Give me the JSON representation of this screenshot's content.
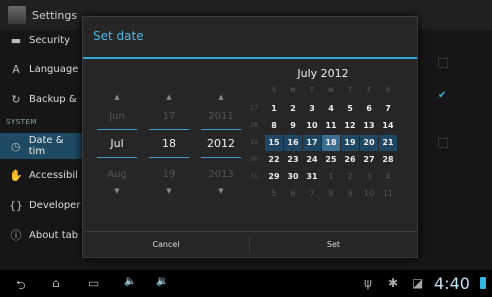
{
  "app": {
    "title": "Settings"
  },
  "sidebar": {
    "items": [
      {
        "label": "Security",
        "icon": "lock-icon"
      },
      {
        "label": "Language",
        "icon": "language-icon"
      },
      {
        "label": "Backup &",
        "icon": "backup-icon"
      },
      {
        "label": "Date & tim",
        "icon": "clock-icon"
      },
      {
        "label": "Accessibil",
        "icon": "hand-icon"
      },
      {
        "label": "Developer",
        "icon": "braces-icon"
      },
      {
        "label": "About tab",
        "icon": "info-icon"
      }
    ],
    "section_header": "SYSTEM"
  },
  "dialog": {
    "title": "Set date",
    "month": {
      "prev": "Jun",
      "current": "Jul",
      "next": "Aug"
    },
    "day": {
      "prev": "17",
      "current": "18",
      "next": "19"
    },
    "year": {
      "prev": "2011",
      "current": "2012",
      "next": "2013"
    },
    "calendar": {
      "title": "July 2012",
      "dow": [
        "S",
        "M",
        "T",
        "W",
        "T",
        "F",
        "S"
      ],
      "weeks": [
        "27",
        "28",
        "29",
        "30",
        "31"
      ],
      "rows": [
        [
          "1",
          "2",
          "3",
          "4",
          "5",
          "6",
          "7"
        ],
        [
          "8",
          "9",
          "10",
          "11",
          "12",
          "13",
          "14"
        ],
        [
          "15",
          "16",
          "17",
          "18",
          "19",
          "20",
          "21"
        ],
        [
          "22",
          "23",
          "24",
          "25",
          "26",
          "27",
          "28"
        ],
        [
          "29",
          "30",
          "31",
          "1",
          "2",
          "3",
          "4"
        ],
        [
          "5",
          "6",
          "7",
          "8",
          "9",
          "10",
          "11"
        ]
      ],
      "selected": "18"
    },
    "cancel_label": "Cancel",
    "set_label": "Set"
  },
  "statusbar": {
    "time": "4:40"
  },
  "colors": {
    "accent": "#33a4d6",
    "selected_bg": "#1f4a63"
  }
}
